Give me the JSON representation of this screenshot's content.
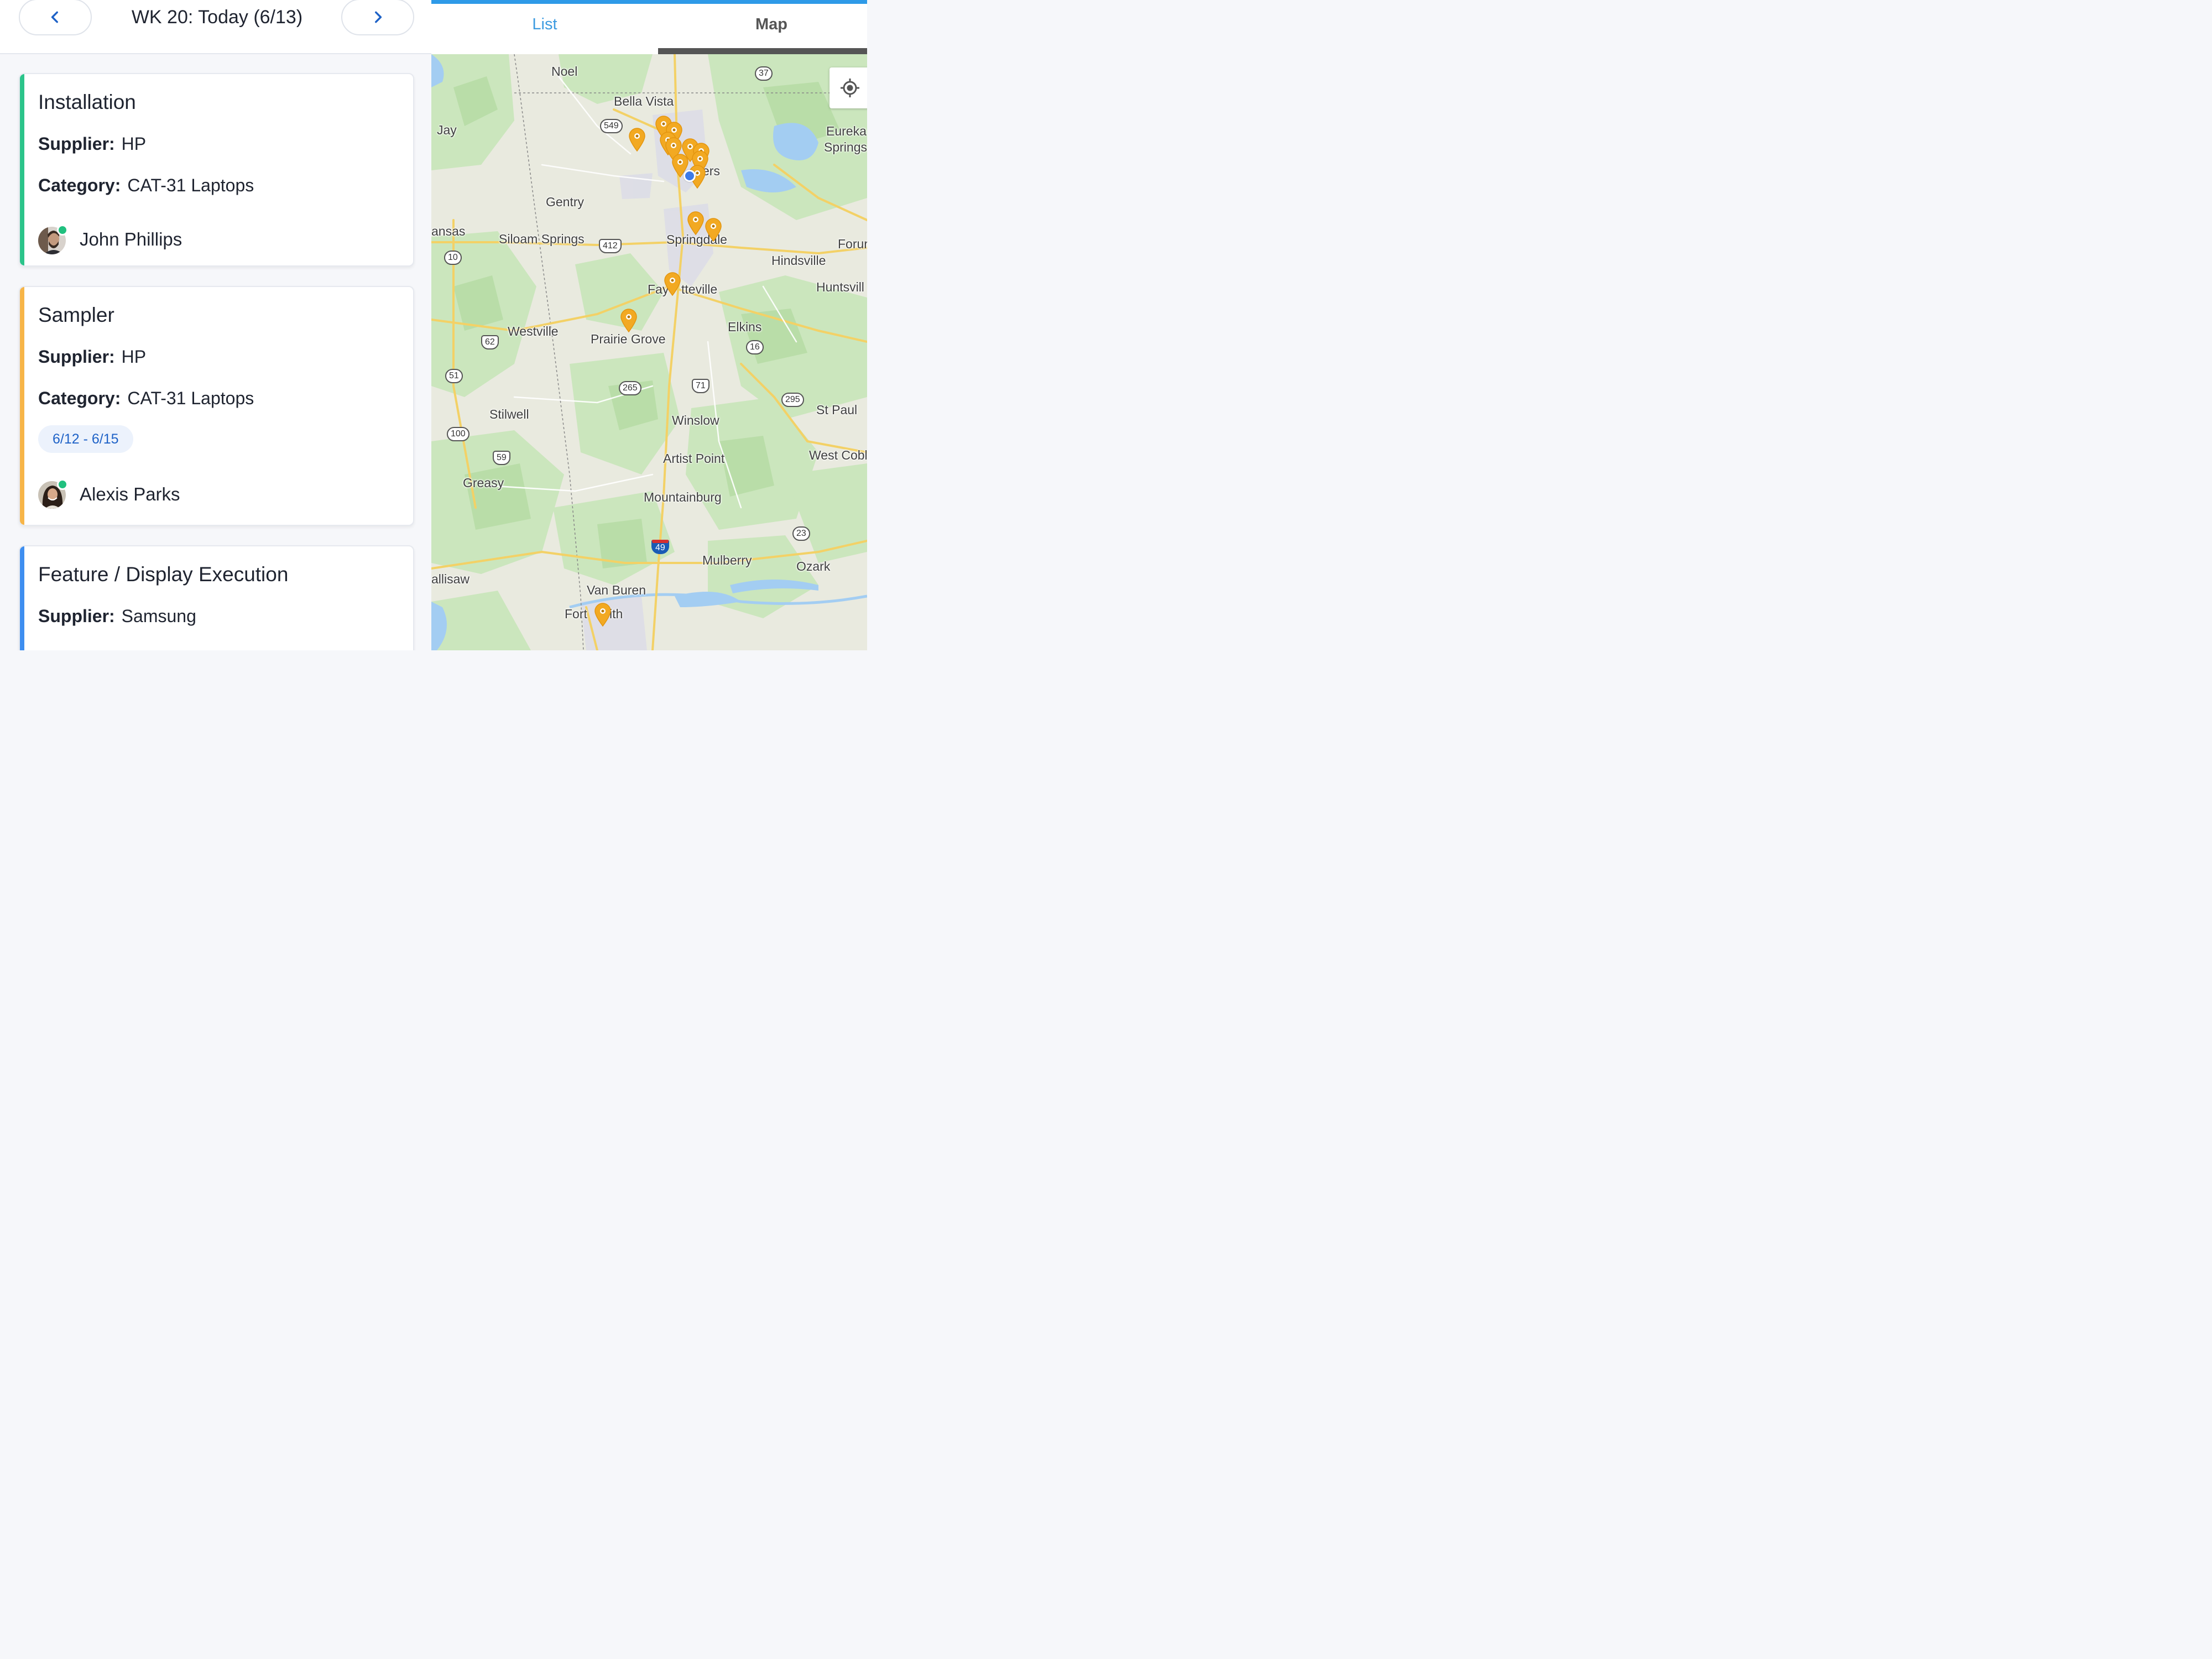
{
  "header": {
    "week_title": "WK 20: Today (6/13)",
    "prev_icon": "chevron-left-icon",
    "next_icon": "chevron-right-icon"
  },
  "cards": [
    {
      "title": "Installation",
      "accent_color": "#2bc48a",
      "supplier_label": "Supplier:",
      "supplier": "HP",
      "category_label": "Category:",
      "category": "CAT-31 Laptops",
      "assignee": "John Phillips"
    },
    {
      "title": "Sampler",
      "accent_color": "#f7b548",
      "supplier_label": "Supplier:",
      "supplier": "HP",
      "category_label": "Category:",
      "category": "CAT-31 Laptops",
      "date_range": "6/12 - 6/15",
      "assignee": "Alexis Parks"
    },
    {
      "title": "Feature / Display Execution",
      "accent_color": "#3e8ef0",
      "supplier_label": "Supplier:",
      "supplier": "Samsung"
    }
  ],
  "tabs": {
    "list": "List",
    "map": "Map",
    "active": "Map"
  },
  "map": {
    "places": [
      "Noel",
      "Bella Vista",
      "Jay",
      "Eureka",
      "Springs",
      "ers",
      "Gentry",
      "ansas",
      "Siloam Springs",
      "Springdale",
      "Forur",
      "Hindsville",
      "Fay",
      "tteville",
      "Huntsvill",
      "Westville",
      "Prairie Grove",
      "Elkins",
      "Stilwell",
      "Winslow",
      "St Paul",
      "Artist Point",
      "West Cobl",
      "Greasy",
      "Mountainburg",
      "Mulberry",
      "Ozark",
      "allisaw",
      "Van Buren",
      "Fort",
      "ith"
    ],
    "highways": [
      "37",
      "549",
      "412",
      "10",
      "62",
      "16",
      "51",
      "265",
      "71",
      "295",
      "100",
      "59",
      "23",
      "49"
    ],
    "pin_color": "#f2a922",
    "location_color": "#3d7bea",
    "locate_icon": "crosshair-icon"
  }
}
